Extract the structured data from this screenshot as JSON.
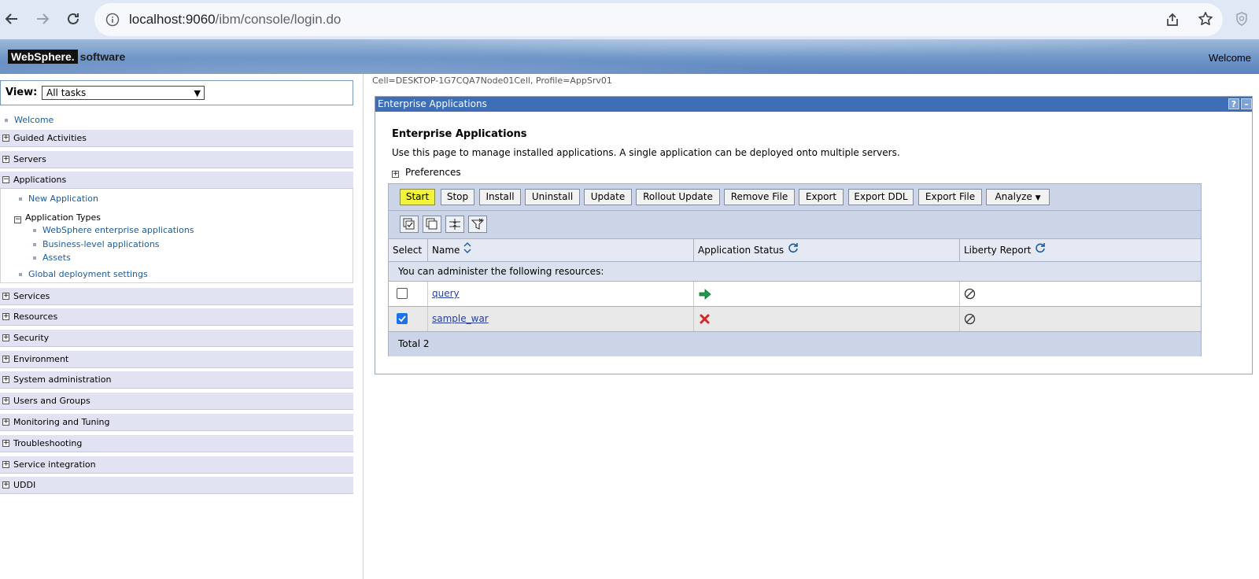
{
  "browser": {
    "url_host": "localhost:9060",
    "url_path": "/ibm/console/login.do"
  },
  "banner": {
    "logo_primary": "WebSphere.",
    "logo_secondary": "software",
    "welcome": "Welcome"
  },
  "leftnav": {
    "view_label": "View:",
    "view_selected": "All tasks",
    "welcome_link": "Welcome",
    "categories": [
      "Guided Activities",
      "Servers",
      "Applications",
      "Services",
      "Resources",
      "Security",
      "Environment",
      "System administration",
      "Users and Groups",
      "Monitoring and Tuning",
      "Troubleshooting",
      "Service integration",
      "UDDI"
    ],
    "applications": {
      "new_application": "New Application",
      "application_types": "Application Types",
      "types": [
        "WebSphere enterprise applications",
        "Business-level applications",
        "Assets"
      ],
      "global_deployment": "Global deployment settings"
    }
  },
  "main": {
    "cell_info": "Cell=DESKTOP-1G7CQA7Node01Cell, Profile=AppSrv01",
    "panel_title": "Enterprise Applications",
    "heading": "Enterprise Applications",
    "description": "Use this page to manage installed applications. A single application can be deployed onto multiple servers.",
    "preferences": "Preferences",
    "buttons": [
      "Start",
      "Stop",
      "Install",
      "Uninstall",
      "Update",
      "Rollout Update",
      "Remove File",
      "Export",
      "Export DDL",
      "Export File",
      "Analyze"
    ],
    "columns": {
      "select": "Select",
      "name": "Name",
      "status": "Application Status",
      "liberty": "Liberty Report"
    },
    "admin_text": "You can administer the following resources:",
    "rows": [
      {
        "name": "query",
        "status": "started",
        "checked": false
      },
      {
        "name": "sample_war",
        "status": "stopped",
        "checked": true
      }
    ],
    "total": "Total 2"
  },
  "colors": {
    "panel_title_bg": "#3e6eb6",
    "nav_category_bg": "#e1e3f3",
    "highlight_button": "#f1f43b",
    "link": "#2a3e9c"
  }
}
